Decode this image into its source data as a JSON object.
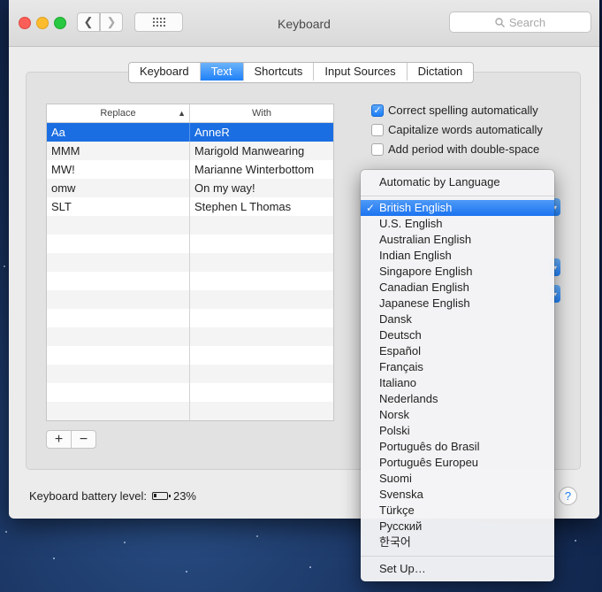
{
  "window": {
    "title": "Keyboard"
  },
  "search": {
    "placeholder": "Search"
  },
  "tabs": [
    "Keyboard",
    "Text",
    "Shortcuts",
    "Input Sources",
    "Dictation"
  ],
  "active_tab": "Text",
  "table": {
    "col_replace": "Replace",
    "col_with": "With",
    "rows": [
      {
        "replace": "Aa",
        "with": "AnneR"
      },
      {
        "replace": "MMM",
        "with": "Marigold Manwearing"
      },
      {
        "replace": "MW!",
        "with": "Marianne Winterbottom"
      },
      {
        "replace": "omw",
        "with": "On my way!"
      },
      {
        "replace": "SLT",
        "with": "Stephen L Thomas"
      }
    ],
    "selected_index": 0
  },
  "options": [
    {
      "label": "Correct spelling automatically",
      "checked": true
    },
    {
      "label": "Capitalize words automatically",
      "checked": false
    },
    {
      "label": "Add period with double-space",
      "checked": false
    }
  ],
  "battery": {
    "label": "Keyboard battery level:",
    "percent": "23%",
    "level": 0.23
  },
  "spelling_menu": {
    "header": "Automatic by Language",
    "items": [
      "British English",
      "U.S. English",
      "Australian English",
      "Indian English",
      "Singapore English",
      "Canadian English",
      "Japanese English",
      "Dansk",
      "Deutsch",
      "Español",
      "Français",
      "Italiano",
      "Nederlands",
      "Norsk",
      "Polski",
      "Português do Brasil",
      "Português Europeu",
      "Suomi",
      "Svenska",
      "Türkçe",
      "Русский",
      "한국어"
    ],
    "selected": "British English",
    "footer": "Set Up…"
  }
}
